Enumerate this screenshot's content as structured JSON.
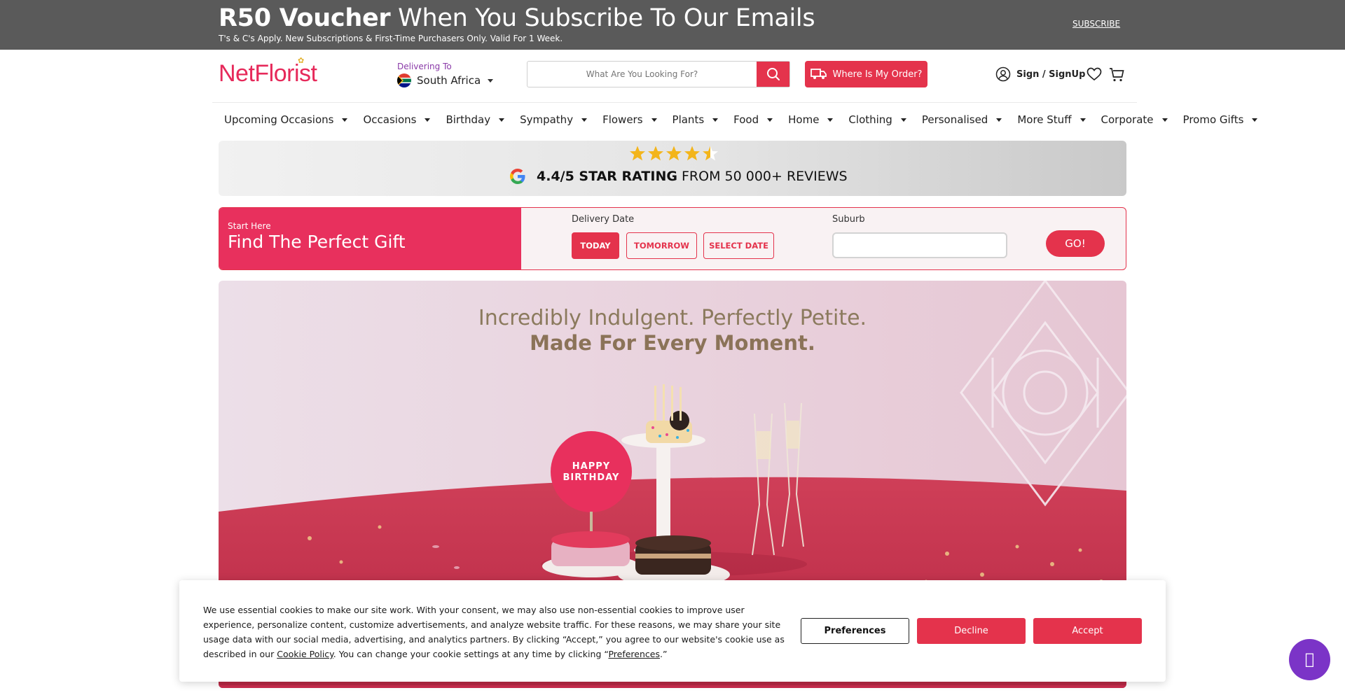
{
  "promo": {
    "title_bold": "R50 Voucher",
    "title_rest": " When You Subscribe To Our Emails",
    "subtitle": "T's & C's Apply. New Subscriptions & First-Time Purchasers Only. Valid For 1 Week.",
    "subscribe_label": "SUBSCRIBE"
  },
  "header": {
    "logo": "NetFlorist",
    "delivering_label": "Delivering To",
    "country": "South Africa",
    "search_placeholder": "What Are You Looking For?",
    "order_button": "Where Is My Order?",
    "signin_label": "Sign / SignUp",
    "icons": [
      "search-icon",
      "delivery-truck-icon",
      "user-icon",
      "heart-icon",
      "cart-icon"
    ]
  },
  "nav": {
    "items": [
      "Upcoming Occasions",
      "Occasions",
      "Birthday",
      "Sympathy",
      "Flowers",
      "Plants",
      "Food",
      "Home",
      "Clothing",
      "Personalised",
      "More Stuff",
      "Corporate",
      "Promo Gifts"
    ]
  },
  "rating": {
    "stars": 4.5,
    "score": "4.4/5 STAR RATING",
    "rest": "FROM 50 000+ REVIEWS"
  },
  "finder": {
    "kicker": "Start Here",
    "title": "Find The Perfect Gift",
    "date_label": "Delivery Date",
    "dates": [
      "TODAY",
      "TOMORROW",
      "SELECT DATE"
    ],
    "suburb_label": "Suburb",
    "suburb_value": "",
    "go_label": "GO!"
  },
  "hero": {
    "line1": "Incredibly Indulgent. Perfectly Petite.",
    "line2": "Made For Every Moment.",
    "sign_text": "HAPPY BIRTHDAY"
  },
  "cookie": {
    "text_before": "We use essential cookies to make our site work. With your consent, we may also use non-essential cookies to improve user experience, personalize content, customize advertisements, and analyze website traffic. For these reasons, we may share your site usage data with our social media, advertising, and analytics partners. By clicking “Accept,” you agree to our website's cookie use as described in our ",
    "policy_link": "Cookie Policy",
    "text_middle": ". You can change your cookie settings at any time by clicking “",
    "preferences_link": "Preferences",
    "text_end": ".”",
    "buttons": {
      "preferences": "Preferences",
      "decline": "Decline",
      "accept": "Accept"
    }
  },
  "chat": {
    "icon": "chat-icon",
    "glyph": ""
  },
  "colors": {
    "brand": "#e4334c",
    "finder_pink": "#e8305d",
    "promo_bg": "#5a5a5a",
    "chat": "#7b34c7",
    "star": "#f3b51b"
  }
}
